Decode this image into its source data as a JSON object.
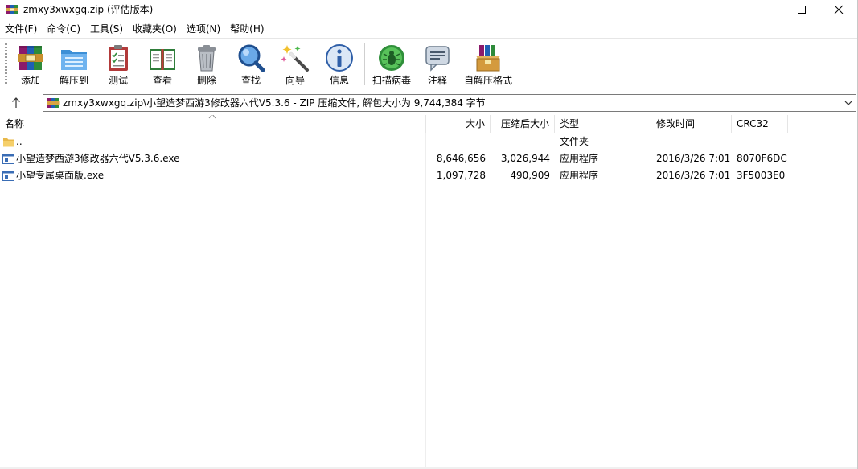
{
  "window": {
    "title": "zmxy3xwxgq.zip (评估版本)"
  },
  "menu": [
    {
      "id": "file",
      "label": "文件(F)"
    },
    {
      "id": "commands",
      "label": "命令(C)"
    },
    {
      "id": "tools",
      "label": "工具(S)"
    },
    {
      "id": "favorites",
      "label": "收藏夹(O)"
    },
    {
      "id": "options",
      "label": "选项(N)"
    },
    {
      "id": "help",
      "label": "帮助(H)"
    }
  ],
  "toolbar": [
    {
      "id": "add",
      "label": "添加",
      "icon": "add-archive-icon"
    },
    {
      "id": "extract",
      "label": "解压到",
      "icon": "extract-folder-icon"
    },
    {
      "id": "test",
      "label": "测试",
      "icon": "test-clipboard-icon"
    },
    {
      "id": "view",
      "label": "查看",
      "icon": "view-book-icon"
    },
    {
      "id": "delete",
      "label": "删除",
      "icon": "trash-icon"
    },
    {
      "id": "find",
      "label": "查找",
      "icon": "magnifier-icon"
    },
    {
      "id": "wizard",
      "label": "向导",
      "icon": "magic-wand-icon"
    },
    {
      "id": "info",
      "label": "信息",
      "icon": "info-icon"
    },
    {
      "id": "virus",
      "label": "扫描病毒",
      "icon": "virus-scan-icon"
    },
    {
      "id": "comment",
      "label": "注释",
      "icon": "comment-icon"
    },
    {
      "id": "sfx",
      "label": "自解压格式",
      "icon": "sfx-box-icon"
    }
  ],
  "address": {
    "path": "zmxy3xwxgq.zip\\小望造梦西游3修改器六代V5.3.6 - ZIP 压缩文件, 解包大小为 9,744,384 字节"
  },
  "columns": {
    "name": "名称",
    "size": "大小",
    "packed": "压缩后大小",
    "type": "类型",
    "modified": "修改时间",
    "crc": "CRC32"
  },
  "files": [
    {
      "name": "..",
      "size": "",
      "packed": "",
      "type": "文件夹",
      "modified": "",
      "crc": "",
      "icon": "folder-icon"
    },
    {
      "name": "小望造梦西游3修改器六代V5.3.6.exe",
      "size": "8,646,656",
      "packed": "3,026,944",
      "type": "应用程序",
      "modified": "2016/3/26 7:01",
      "crc": "8070F6DC",
      "icon": "exe-file-icon"
    },
    {
      "name": "小望专属桌面版.exe",
      "size": "1,097,728",
      "packed": "490,909",
      "type": "应用程序",
      "modified": "2016/3/26 7:01",
      "crc": "3F5003E0",
      "icon": "exe-file-icon"
    }
  ]
}
